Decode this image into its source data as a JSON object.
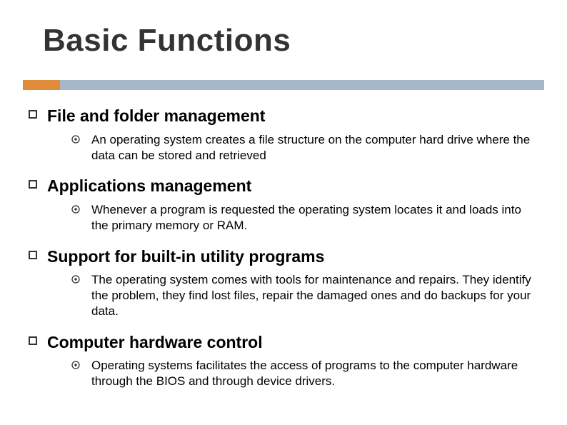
{
  "title": "Basic Functions",
  "colors": {
    "accent_orange": "#e08b3a",
    "accent_blue": "#a6b8c8"
  },
  "items": [
    {
      "heading": "File and folder management",
      "sub": [
        "An operating system creates a file structure on the computer hard drive where the data can be stored and retrieved"
      ]
    },
    {
      "heading": "Applications management",
      "sub": [
        "Whenever a program is requested the operating system locates it and loads into the primary memory or RAM."
      ]
    },
    {
      "heading": "Support for built-in utility programs",
      "sub": [
        "The operating system comes with tools for maintenance and repairs. They identify the problem, they find lost files, repair the damaged ones and do backups for your data."
      ]
    },
    {
      "heading": "Computer hardware control",
      "sub": [
        "Operating systems facilitates the access of programs to the computer hardware through the BIOS and through device drivers."
      ]
    }
  ]
}
